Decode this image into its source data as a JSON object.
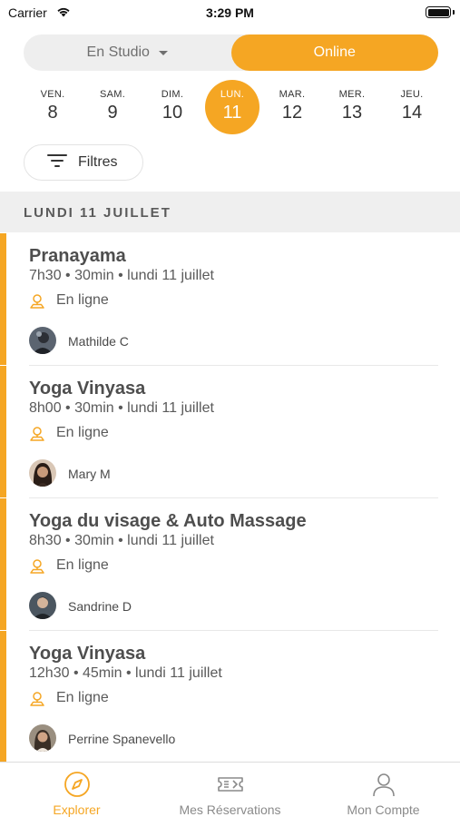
{
  "status_bar": {
    "carrier": "Carrier",
    "time": "3:29 PM"
  },
  "mode_toggle": {
    "studio_label": "En Studio",
    "online_label": "Online",
    "selected": "online"
  },
  "days": [
    {
      "name": "VEN.",
      "num": "8",
      "selected": false
    },
    {
      "name": "SAM.",
      "num": "9",
      "selected": false
    },
    {
      "name": "DIM.",
      "num": "10",
      "selected": false
    },
    {
      "name": "LUN.",
      "num": "11",
      "selected": true
    },
    {
      "name": "MAR.",
      "num": "12",
      "selected": false
    },
    {
      "name": "MER.",
      "num": "13",
      "selected": false
    },
    {
      "name": "JEU.",
      "num": "14",
      "selected": false
    }
  ],
  "filter": {
    "label": "Filtres"
  },
  "section": {
    "title": "LUNDI 11 JUILLET"
  },
  "classes": [
    {
      "title": "Pranayama",
      "meta": "7h30 • 30min • lundi 11 juillet",
      "location": "En ligne",
      "teacher": "Mathilde C"
    },
    {
      "title": "Yoga Vinyasa",
      "meta": "8h00 • 30min • lundi 11 juillet",
      "location": "En ligne",
      "teacher": "Mary M"
    },
    {
      "title": "Yoga du visage & Auto Massage",
      "meta": "8h30 • 30min • lundi 11 juillet",
      "location": "En ligne",
      "teacher": "Sandrine D"
    },
    {
      "title": "Yoga Vinyasa",
      "meta": "12h30 • 45min • lundi 11 juillet",
      "location": "En ligne",
      "teacher": "Perrine Spanevello"
    }
  ],
  "tabs": {
    "explorer": "Explorer",
    "reservations": "Mes Réservations",
    "account": "Mon Compte",
    "active": "explorer"
  },
  "colors": {
    "accent": "#f5a623",
    "text": "#4a4a4a",
    "muted": "#8a8a8a"
  }
}
